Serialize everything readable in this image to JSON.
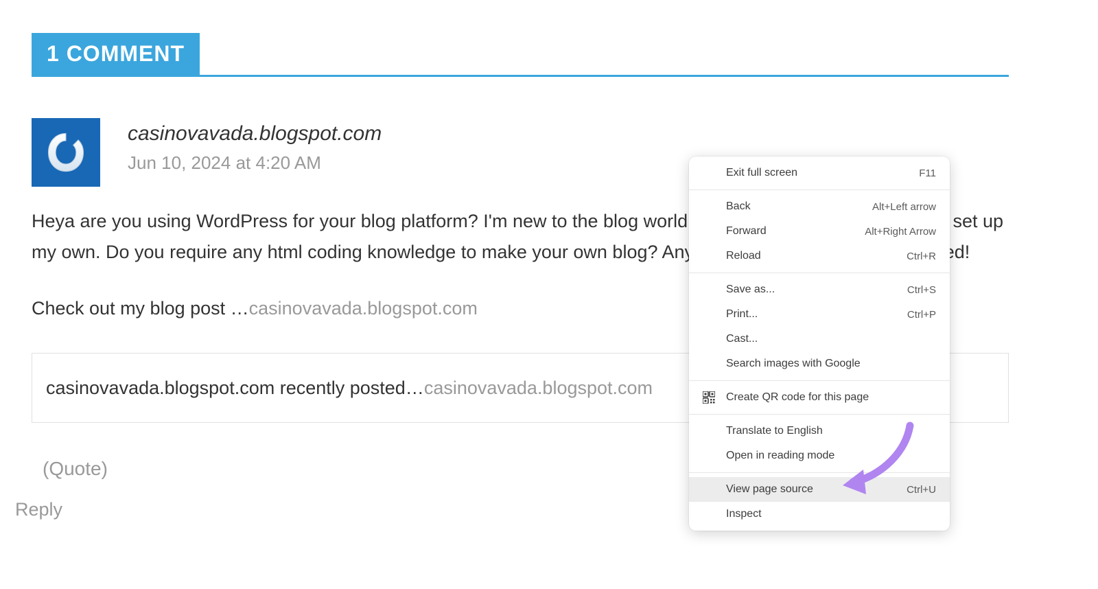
{
  "header": {
    "comments_label": "1 COMMENT"
  },
  "comment": {
    "author": "casinovavada.blogspot.com",
    "date": "Jun 10, 2024 at 4:20 AM",
    "paragraph1": "Heya are you using WordPress for your blog platform? I'm new to the blog world but I'm trying to get started and set up my own. Do you require any html coding knowledge to make your own blog? Any help would be really appreciated!",
    "paragraph2_pre": "Check out my blog post …",
    "paragraph2_link": "casinovavada.blogspot.com",
    "recent_pre": "casinovavada.blogspot.com recently posted…",
    "recent_link": "casinovavada.blogspot.com",
    "quote_label": "(Quote)",
    "reply_label": "Reply"
  },
  "context_menu": {
    "exit_full_screen": "Exit full screen",
    "exit_full_screen_key": "F11",
    "back": "Back",
    "back_key": "Alt+Left arrow",
    "forward": "Forward",
    "forward_key": "Alt+Right Arrow",
    "reload": "Reload",
    "reload_key": "Ctrl+R",
    "save_as": "Save as...",
    "save_as_key": "Ctrl+S",
    "print": "Print...",
    "print_key": "Ctrl+P",
    "cast": "Cast...",
    "search_images": "Search images with Google",
    "create_qr": "Create QR code for this page",
    "translate": "Translate to English",
    "reading_mode": "Open in reading mode",
    "view_source": "View page source",
    "view_source_key": "Ctrl+U",
    "inspect": "Inspect"
  }
}
